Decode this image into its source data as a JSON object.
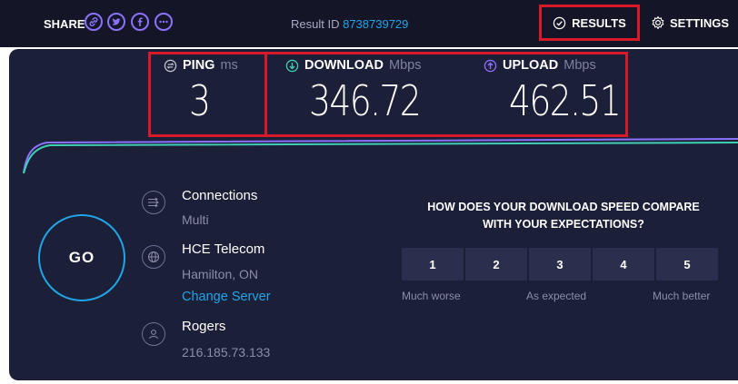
{
  "header": {
    "share_label": "SHARE",
    "share_icons": [
      "link-icon",
      "twitter-icon",
      "facebook-icon",
      "more-icon"
    ],
    "result_label": "Result ID",
    "result_id": "8738739729",
    "results_label": "RESULTS",
    "settings_label": "SETTINGS"
  },
  "metrics": {
    "ping": {
      "label": "PING",
      "unit": "ms",
      "value": "3"
    },
    "download": {
      "label": "DOWNLOAD",
      "unit": "Mbps",
      "value": "346.72"
    },
    "upload": {
      "label": "UPLOAD",
      "unit": "Mbps",
      "value": "462.51"
    }
  },
  "go_label": "GO",
  "info": {
    "connections_title": "Connections",
    "connections_value": "Multi",
    "server_name": "HCE Telecom",
    "server_location": "Hamilton, ON",
    "change_server": "Change Server",
    "isp_name": "Rogers",
    "isp_ip": "216.185.73.133"
  },
  "survey": {
    "question_line1": "HOW DOES YOUR DOWNLOAD SPEED COMPARE",
    "question_line2": "WITH YOUR EXPECTATIONS?",
    "options": [
      "1",
      "2",
      "3",
      "4",
      "5"
    ],
    "label_low": "Much worse",
    "label_mid": "As expected",
    "label_high": "Much better"
  },
  "colors": {
    "accent": "#1fa6e8",
    "highlight": "#d8192a",
    "upload": "#8a72ff",
    "download": "#3fd0b4"
  }
}
